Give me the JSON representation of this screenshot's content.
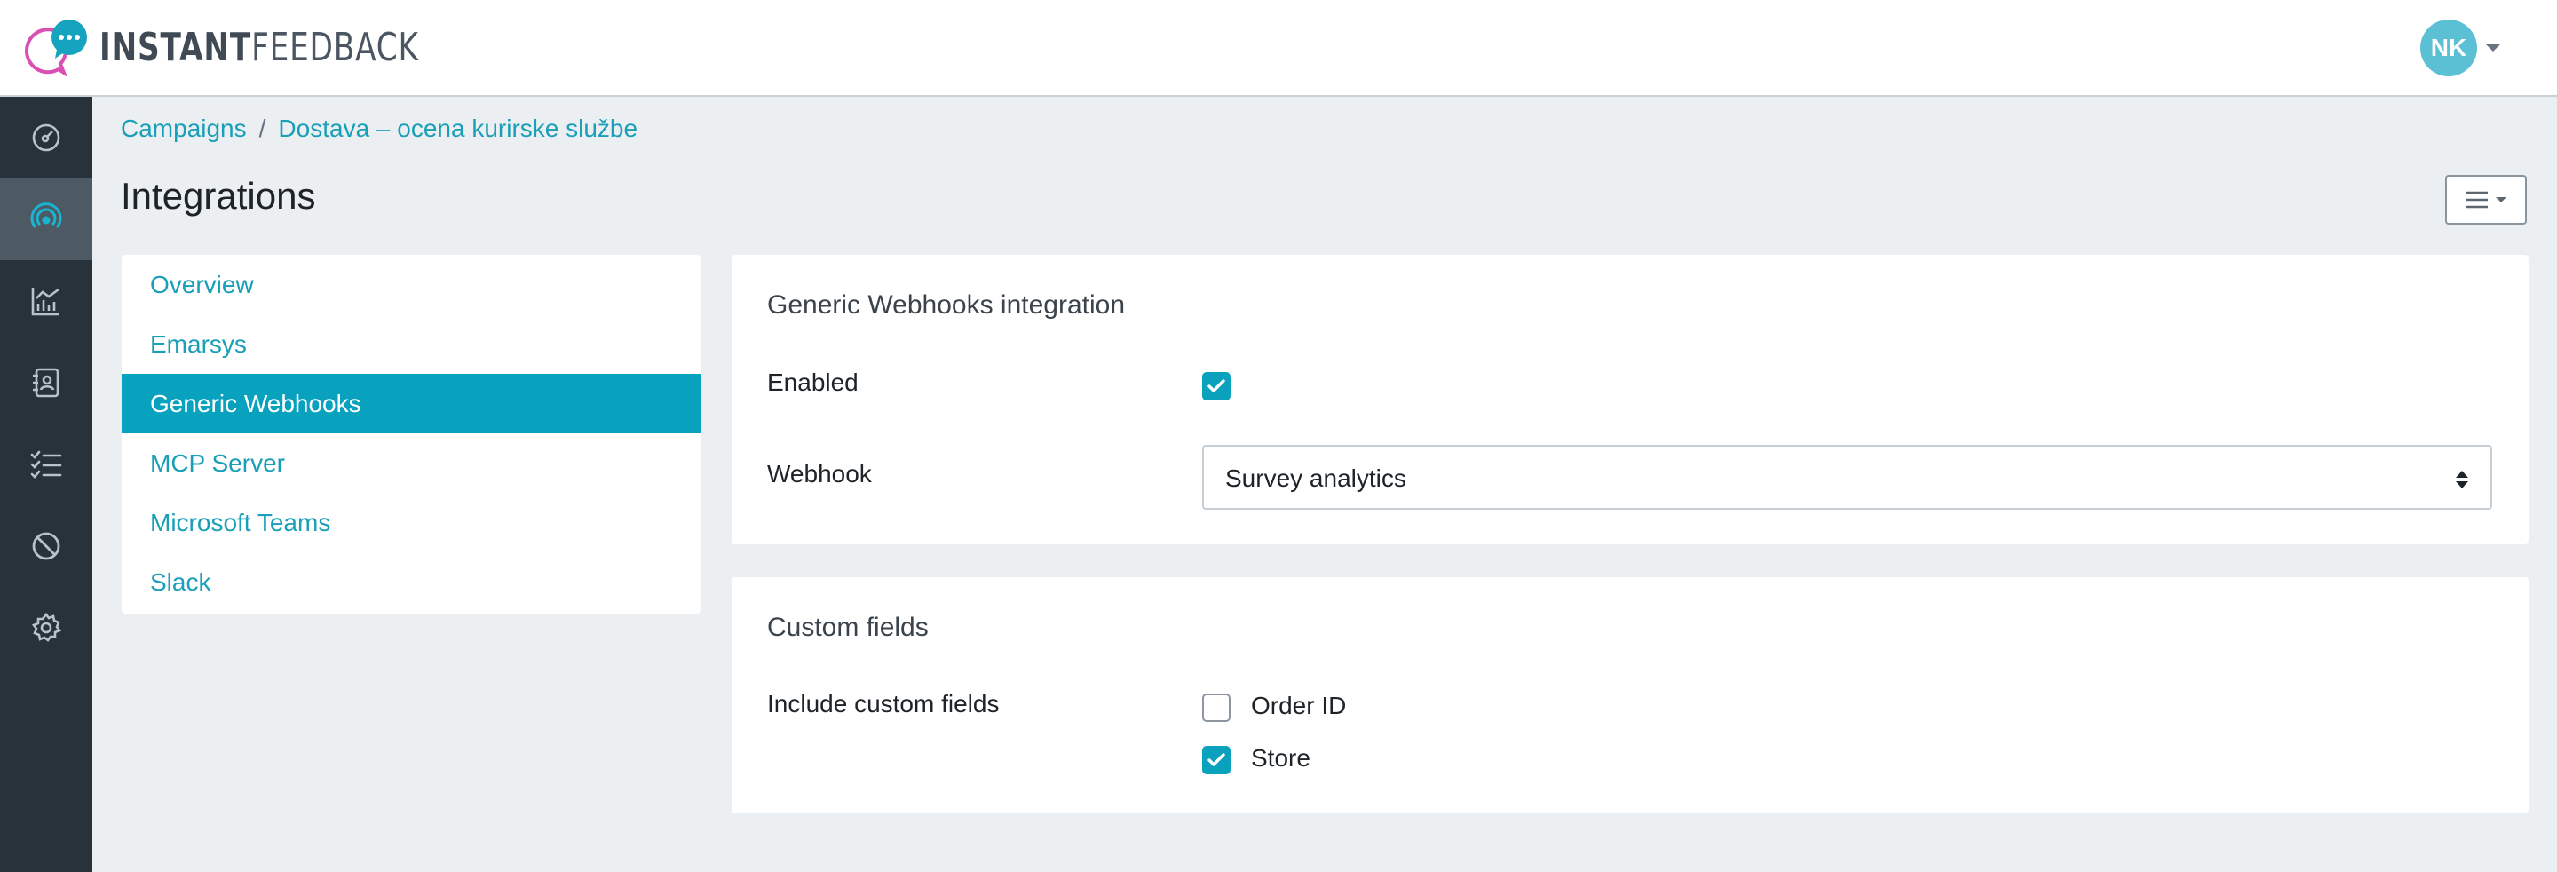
{
  "app": {
    "logo_strong": "INSTANT",
    "logo_light": "FEEDBACK",
    "user_initials": "NK"
  },
  "sidebar": {
    "items": [
      {
        "icon": "dashboard-icon",
        "active": false
      },
      {
        "icon": "broadcast-icon",
        "active": true
      },
      {
        "icon": "analytics-icon",
        "active": false
      },
      {
        "icon": "contacts-icon",
        "active": false
      },
      {
        "icon": "tasks-icon",
        "active": false
      },
      {
        "icon": "block-icon",
        "active": false
      },
      {
        "icon": "settings-icon",
        "active": false
      }
    ]
  },
  "breadcrumb": {
    "items": [
      "Campaigns",
      "Dostava – ocena kurirske službe"
    ],
    "separator": "/"
  },
  "page": {
    "title": "Integrations"
  },
  "nav": {
    "items": [
      "Overview",
      "Emarsys",
      "Generic Webhooks",
      "MCP Server",
      "Microsoft Teams",
      "Slack"
    ],
    "active": "Generic Webhooks"
  },
  "webhooks_card": {
    "title": "Generic Webhooks integration",
    "enabled_label": "Enabled",
    "enabled": true,
    "webhook_label": "Webhook",
    "webhook_value": "Survey analytics"
  },
  "custom_fields_card": {
    "title": "Custom fields",
    "include_label": "Include custom fields",
    "fields": [
      {
        "label": "Order ID",
        "checked": false
      },
      {
        "label": "Store",
        "checked": true
      }
    ]
  },
  "colors": {
    "accent": "#08a2bf",
    "link": "#1a9fb8",
    "sidebar_bg": "#27323b",
    "sidebar_active": "#4d5a64",
    "avatar": "#5bc0d3",
    "logo_bubble_outline": "#d94fb3",
    "logo_bubble_fill": "#16a3c0"
  }
}
